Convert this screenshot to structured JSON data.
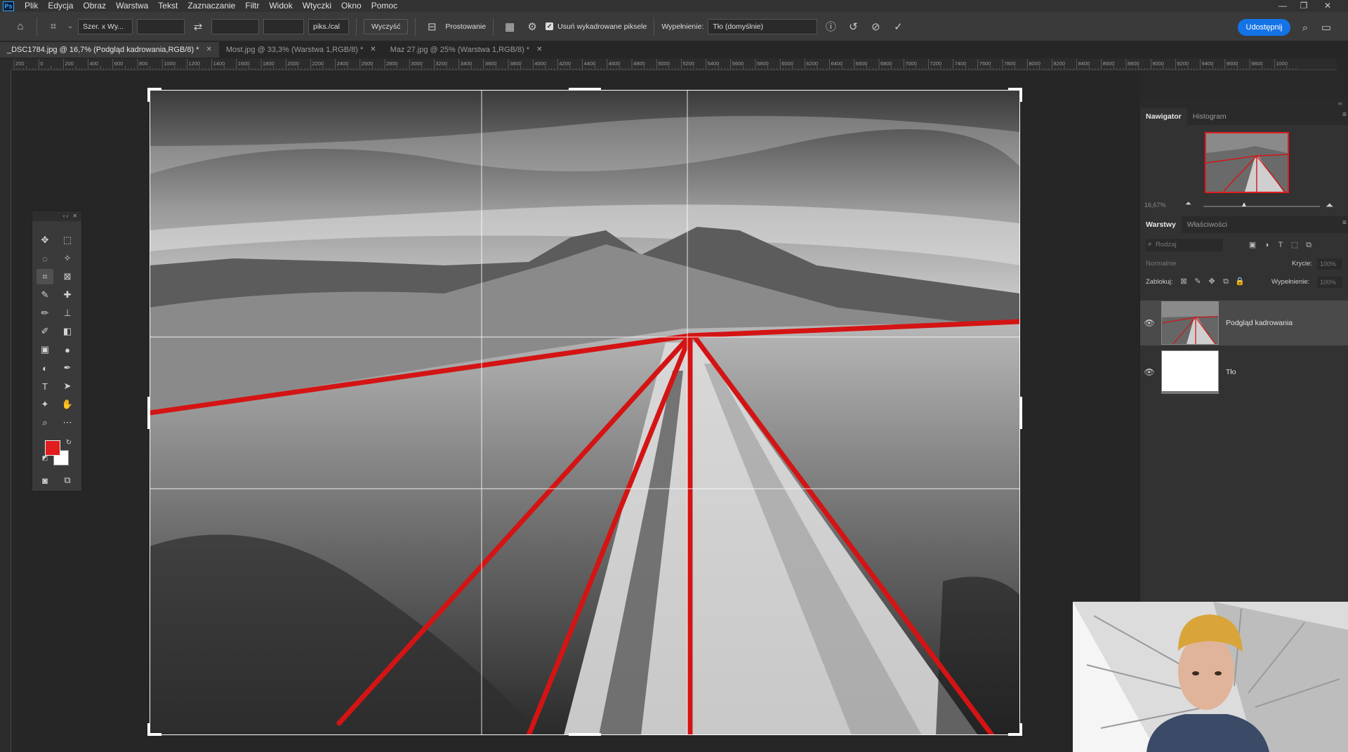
{
  "app": {
    "logo": "Ps"
  },
  "menu": [
    "Plik",
    "Edycja",
    "Obraz",
    "Warstwa",
    "Tekst",
    "Zaznaczanie",
    "Filtr",
    "Widok",
    "Wtyczki",
    "Okno",
    "Pomoc"
  ],
  "options_bar": {
    "ratio_preset": "Szer. x Wy...",
    "resolution_unit": "piks./cal",
    "clear_label": "Wyczyść",
    "straighten_label": "Prostowanie",
    "delete_cropped_label": "Usuń wykadrowane piksele",
    "fill_label": "Wypełnienie:",
    "fill_value": "Tło (domyślnie)",
    "share_label": "Udostępnij"
  },
  "tabs": [
    {
      "label": "_DSC1784.jpg @ 16,7% (Podgląd kadrowania,RGB/8) *",
      "active": true
    },
    {
      "label": "Most.jpg @ 33,3% (Warstwa 1,RGB/8) *",
      "active": false
    },
    {
      "label": "Maz 27.jpg @ 25% (Warstwa 1,RGB/8) *",
      "active": false
    }
  ],
  "ruler_labels": [
    "200",
    "0",
    "200",
    "400",
    "600",
    "800",
    "1000",
    "1200",
    "1400",
    "1600",
    "1800",
    "2000",
    "2200",
    "2400",
    "2600",
    "2800",
    "3000",
    "3200",
    "3400",
    "3600",
    "3800",
    "4000",
    "4200",
    "4400",
    "4600",
    "4800",
    "5000",
    "5200",
    "5400",
    "5600",
    "5800",
    "6000",
    "6200",
    "6400",
    "6600",
    "6800",
    "7000",
    "7200",
    "7400",
    "7600",
    "7800",
    "8000",
    "8200",
    "8400",
    "8600",
    "8800",
    "9000",
    "9200",
    "9400",
    "9600",
    "9800",
    "1000"
  ],
  "navigator": {
    "tab_active": "Nawigator",
    "tab_other": "Histogram",
    "zoom": "16,67%"
  },
  "layers_panel": {
    "tab_active": "Warstwy",
    "tab_other": "Właściwości",
    "search_placeholder": "Rodzaj",
    "blend_mode": "Normalnie",
    "opacity_label": "Krycie:",
    "opacity_value": "100%",
    "lock_label": "Zablokuj:",
    "fill_label": "Wypełnienie:",
    "fill_value": "100%",
    "layers": [
      {
        "name": "Podgląd kadrowania",
        "selected": true
      },
      {
        "name": "Tło",
        "selected": false
      }
    ]
  },
  "colors": {
    "foreground": "#e01e1e",
    "background": "#ffffff",
    "accent": "#1473e6"
  }
}
